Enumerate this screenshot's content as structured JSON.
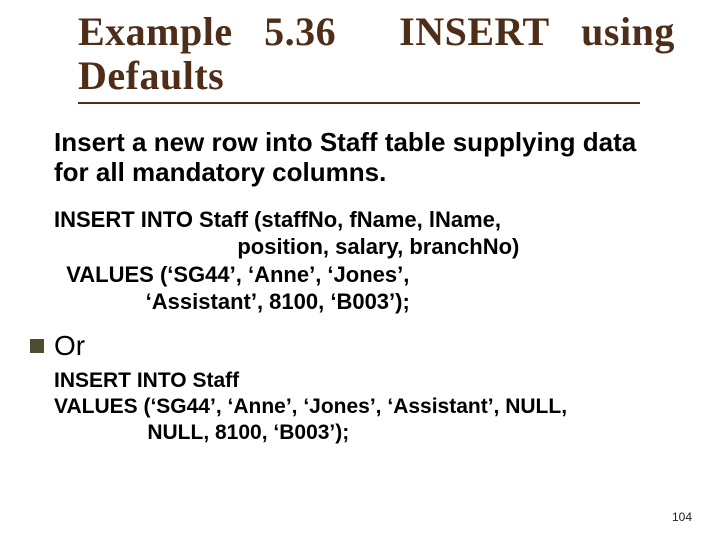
{
  "title": {
    "line1_a": "Example",
    "line1_num": "5.36",
    "line1_b": "INSERT",
    "line1_c": "using",
    "line2": "Defaults"
  },
  "lead": "Insert a new row into Staff table supplying data for all mandatory columns.",
  "code1": "INSERT INTO Staff (staffNo, fName, lName,\n                              position, salary, branchNo)\n  VALUES (‘SG44’, ‘Anne’, ‘Jones’,\n               ‘Assistant’, 8100, ‘B003’);",
  "or_label": "Or",
  "code2": "INSERT INTO Staff\nVALUES (‘SG44’, ‘Anne’, ‘Jones’, ‘Assistant’, NULL,\n                NULL, 8100, ‘B003’);",
  "page_number": "104"
}
